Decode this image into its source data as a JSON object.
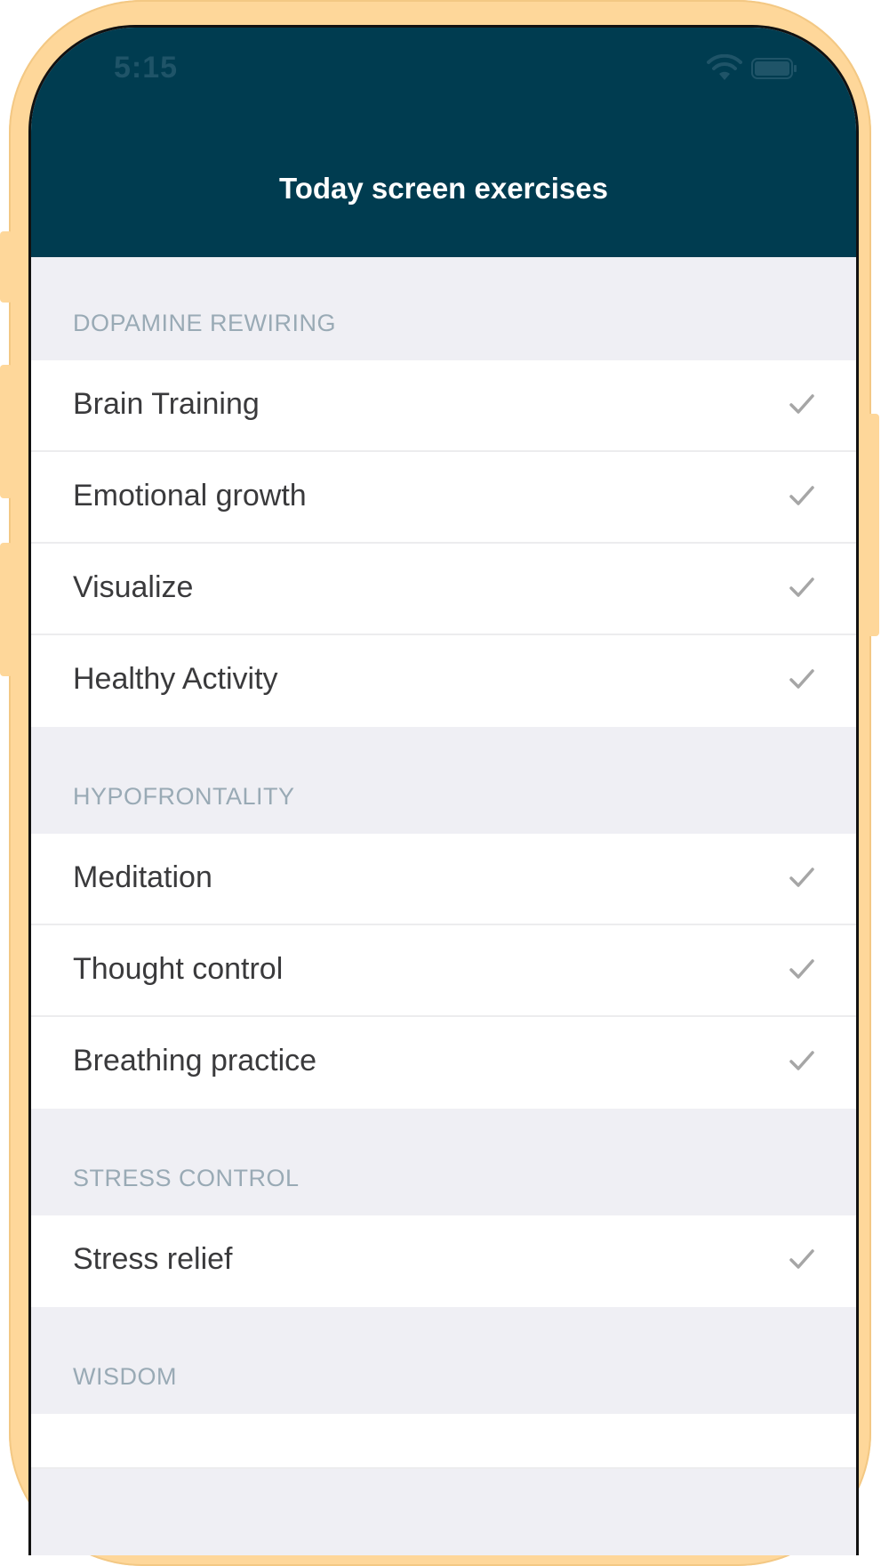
{
  "status_bar": {
    "time": "5:15",
    "wifi_icon": "wifi-icon",
    "battery_icon": "battery-icon"
  },
  "nav": {
    "title": "Today screen exercises"
  },
  "colors": {
    "nav_background": "#003c50",
    "device_frame": "#fed79a",
    "section_header_text": "#99aab5",
    "check_color": "#a6a6a6"
  },
  "sections": [
    {
      "header": "DOPAMINE REWIRING",
      "items": [
        {
          "label": "Brain Training",
          "checked": true
        },
        {
          "label": "Emotional growth",
          "checked": true
        },
        {
          "label": "Visualize",
          "checked": true
        },
        {
          "label": "Healthy Activity",
          "checked": true
        }
      ]
    },
    {
      "header": "HYPOFRONTALITY",
      "items": [
        {
          "label": "Meditation",
          "checked": true
        },
        {
          "label": "Thought control",
          "checked": true
        },
        {
          "label": "Breathing practice",
          "checked": true
        }
      ]
    },
    {
      "header": "STRESS CONTROL",
      "items": [
        {
          "label": "Stress relief",
          "checked": true
        }
      ]
    },
    {
      "header": "WISDOM",
      "items": []
    }
  ]
}
